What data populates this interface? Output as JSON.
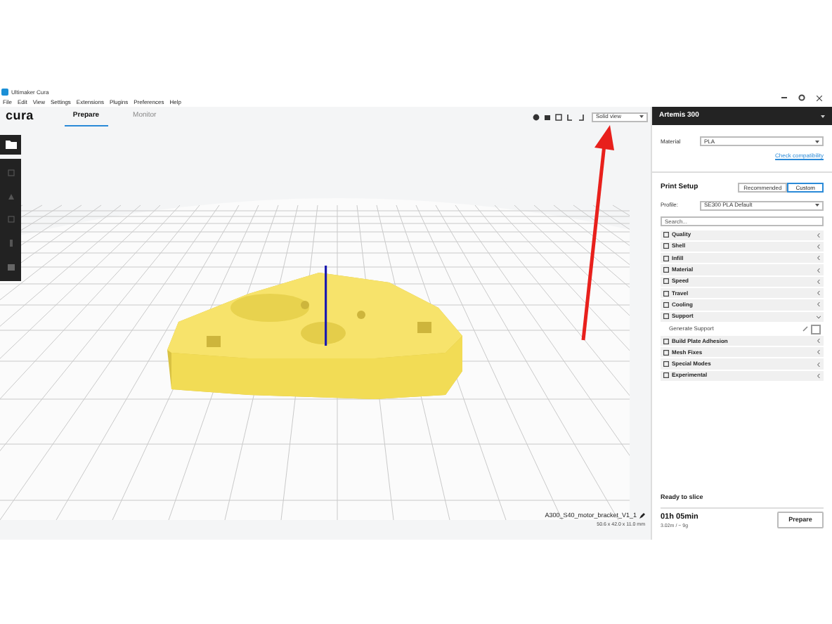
{
  "window": {
    "title": "Ultimaker Cura"
  },
  "menu": [
    "File",
    "Edit",
    "View",
    "Settings",
    "Extensions",
    "Plugins",
    "Preferences",
    "Help"
  ],
  "header": {
    "logo": "cura",
    "tabs": [
      {
        "label": "Prepare",
        "selected": true
      },
      {
        "label": "Monitor",
        "selected": false
      }
    ],
    "view_mode": "Solid view"
  },
  "printer": {
    "name": "Artemis 300",
    "material_label": "Material",
    "material": "PLA",
    "compatibility_link": "Check compatibility"
  },
  "print_setup": {
    "title": "Print Setup",
    "modes": [
      {
        "label": "Recommended",
        "selected": false
      },
      {
        "label": "Custom",
        "selected": true
      }
    ],
    "profile_label": "Profile:",
    "profile": "SE300 PLA Default",
    "search_placeholder": "Search..."
  },
  "settings": [
    {
      "kind": "category",
      "label": "Quality",
      "expanded": false
    },
    {
      "kind": "category",
      "label": "Shell",
      "expanded": false
    },
    {
      "kind": "category",
      "label": "Infill",
      "expanded": false
    },
    {
      "kind": "category",
      "label": "Material",
      "expanded": false
    },
    {
      "kind": "category",
      "label": "Speed",
      "expanded": false
    },
    {
      "kind": "category",
      "label": "Travel",
      "expanded": false
    },
    {
      "kind": "category",
      "label": "Cooling",
      "expanded": false
    },
    {
      "kind": "category",
      "label": "Support",
      "expanded": true
    },
    {
      "kind": "checkbox",
      "label": "Generate Support",
      "checked": false
    },
    {
      "kind": "category",
      "label": "Build Plate Adhesion",
      "expanded": false
    },
    {
      "kind": "category",
      "label": "Mesh Fixes",
      "expanded": false
    },
    {
      "kind": "category",
      "label": "Special Modes",
      "expanded": false
    },
    {
      "kind": "category",
      "label": "Experimental",
      "expanded": false
    }
  ],
  "object": {
    "name": "A300_S40_motor_bracket_V1_1",
    "dimensions": "50.6 x 42.0 x 11.0 mm"
  },
  "slice": {
    "status": "Ready to slice",
    "time": "01h 05min",
    "usage": "3.02m / ~ 9g",
    "button": "Prepare"
  }
}
